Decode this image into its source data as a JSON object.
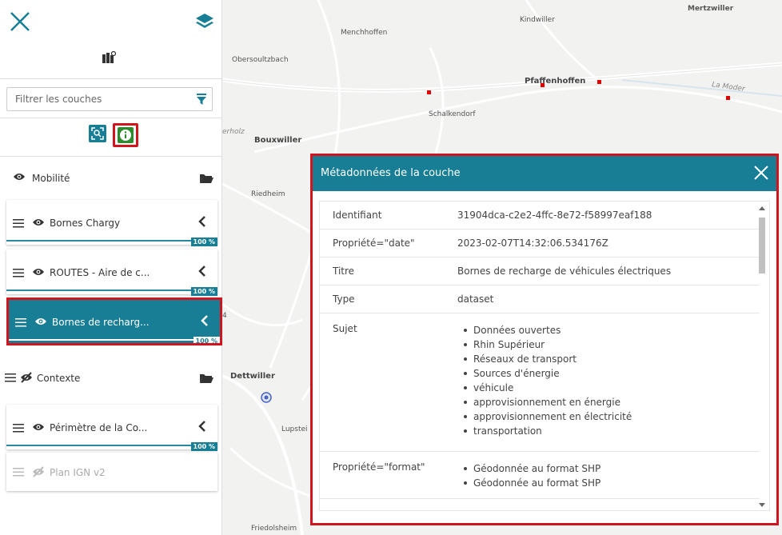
{
  "sidebar": {
    "filter_placeholder": "Filtrer les couches",
    "groups": [
      {
        "name": "Mobilité",
        "visible": true
      },
      {
        "name": "Contexte",
        "visible": false
      }
    ],
    "layers": [
      {
        "name": "Bornes Chargy",
        "opacity": "100 %"
      },
      {
        "name": "ROUTES - Aire de c...",
        "opacity": "100 %"
      },
      {
        "name": "Bornes de recharg...",
        "opacity": "100 %",
        "active": true
      },
      {
        "name": "Périmètre de la Co...",
        "opacity": "100 %"
      },
      {
        "name": "Plan IGN v2",
        "visible": false
      }
    ]
  },
  "map": {
    "places": [
      "Mertzwiller",
      "Kindwiller",
      "Menchhoffen",
      "Obersoultzbach",
      "Pfaffenhoffen",
      "La Moder",
      "Schalkendorf",
      "erholz",
      "Bouxwiller",
      "Riedheim",
      "Dettwiller",
      "Lupstei",
      "Friedolsheim",
      "4"
    ]
  },
  "panel": {
    "title": "Métadonnées de la couche",
    "rows": [
      {
        "key": "Identifiant",
        "value": "31904dca-c2e2-4ffc-8e72-f58997eaf188"
      },
      {
        "key": "Propriété=\"date\"",
        "value": "2023-02-07T14:32:06.534176Z"
      },
      {
        "key": "Titre",
        "value": "Bornes de recharge de véhicules électriques"
      },
      {
        "key": "Type",
        "value": "dataset"
      },
      {
        "key": "Sujet",
        "items": [
          "Données ouvertes",
          "Rhin Supérieur",
          "Réseaux de transport",
          "Sources d'énergie",
          "véhicule",
          "approvisionnement en énergie",
          "approvisionnement en électricité",
          "transportation"
        ]
      },
      {
        "key": "Propriété=\"format\"",
        "items": [
          "Géodonnée au format SHP",
          "Géodonnée au format SHP"
        ]
      }
    ]
  },
  "colors": {
    "accent": "#177e95",
    "highlight": "#d2141e",
    "info_button": "#2c8b2c"
  }
}
